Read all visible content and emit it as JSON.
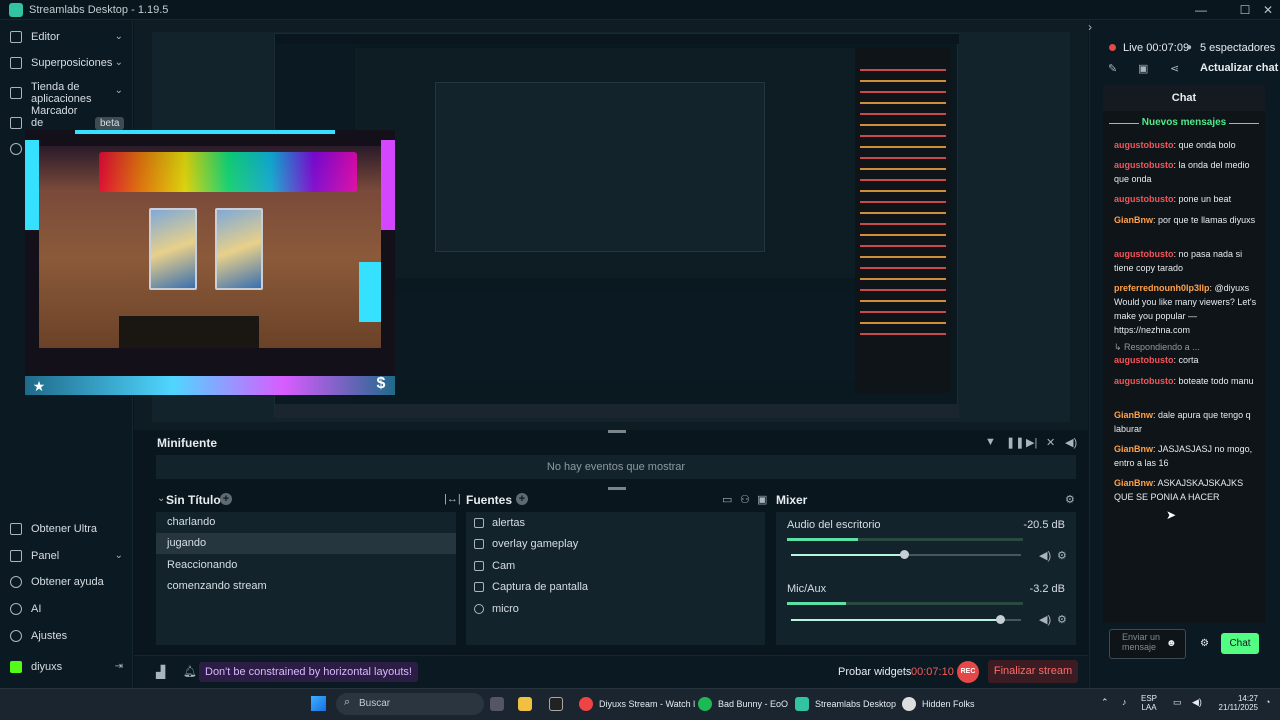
{
  "app": {
    "title": "Streamlabs Desktop - 1.19.5"
  },
  "sidebar": {
    "items": [
      {
        "label": "Editor",
        "icon": "editor-icon"
      },
      {
        "label": "Superposiciones",
        "icon": "overlays-icon"
      },
      {
        "label": "Tienda de aplicaciones",
        "icon": "app-store-icon"
      },
      {
        "label": "Marcador de resultado",
        "icon": "highlighter-icon",
        "badge": "beta"
      }
    ],
    "bottom": [
      {
        "label": "Obtener Ultra",
        "icon": "ultra-icon"
      },
      {
        "label": "Panel",
        "icon": "dashboard-icon"
      },
      {
        "label": "Obtener ayuda",
        "icon": "help-icon"
      },
      {
        "label": "AI",
        "icon": "ai-icon"
      },
      {
        "label": "Ajustes",
        "icon": "settings-icon"
      },
      {
        "label": "diyuxs",
        "icon": "kick-icon"
      }
    ]
  },
  "minifuente": {
    "title": "Minifuente",
    "empty": "No hay eventos que mostrar"
  },
  "scenes": {
    "title": "Sin Título",
    "items": [
      "charlando",
      "jugando",
      "Reaccionando",
      "comenzando stream"
    ],
    "selected": 1
  },
  "sources": {
    "title": "Fuentes",
    "items": [
      "alertas",
      "overlay gameplay",
      "Cam",
      "Captura de pantalla",
      "micro"
    ]
  },
  "mixer": {
    "title": "Mixer",
    "channels": [
      {
        "name": "Audio del escritorio",
        "db": "-20.5 dB",
        "level": 0.3,
        "volume": 0.49
      },
      {
        "name": "Mic/Aux",
        "db": "-3.2 dB",
        "level": 0.25,
        "volume": 0.91
      }
    ]
  },
  "footer": {
    "promo": "Don't be constrained by horizontal layouts!",
    "probar": "Probar widgets",
    "time": "00:07:10",
    "rec": "REC",
    "end": "Finalizar stream"
  },
  "live": {
    "label": "Live",
    "time": "00:07:09",
    "viewers": "5 espectadores",
    "action": "Actualizar chat"
  },
  "chat": {
    "title": "Chat",
    "new_messages": "Nuevos mensajes",
    "reply_label": "Respondiendo a ...",
    "input_placeholder": "Enviar un mensaje",
    "send": "Chat",
    "messages": [
      {
        "user": "augustobusto",
        "text": "que onda bolo",
        "cls": "u1"
      },
      {
        "user": "augustobusto",
        "text": "la onda del medio que onda",
        "cls": "u1"
      },
      {
        "user": "augustobusto",
        "text": "pone un beat",
        "cls": "u1"
      },
      {
        "user": "GianBnw",
        "text": "por que te llamas diyuxs",
        "cls": "u2"
      },
      {
        "user": "augustobusto",
        "text": "no pasa nada si tiene copy tarado",
        "cls": "u1"
      },
      {
        "user": "preferrednounh0lp3llp",
        "text": "@diyuxs Would you like many viewers? Let's make you popular — https://nezhna.com",
        "cls": "u2"
      },
      {
        "user": "augustobusto",
        "text": "corta",
        "cls": "u1"
      },
      {
        "user": "augustobusto",
        "text": "boteate todo manu",
        "cls": "u1"
      },
      {
        "user": "GianBnw",
        "text": "dale apura que tengo q laburar",
        "cls": "u2"
      },
      {
        "user": "GianBnw",
        "text": "JASJASJASJ no mogo, entro a las 16",
        "cls": "u2"
      },
      {
        "user": "GianBnw",
        "text": "ASKAJSKAJSKAJKS QUE SE PONIA A HACER",
        "cls": "u2"
      }
    ]
  },
  "taskbar": {
    "search": "Buscar",
    "apps": [
      {
        "label": "Diyuxs Stream - Watch l",
        "color": "#e44"
      },
      {
        "label": "Bad Bunny - EoO",
        "color": "#1db954"
      },
      {
        "label": "Streamlabs Desktop",
        "color": "#31c3a2"
      },
      {
        "label": "Hidden Folks",
        "color": "#ddd"
      }
    ],
    "lang": "ESP",
    "lang2": "LAA",
    "time": "14:27",
    "date": "21/11/2025"
  }
}
